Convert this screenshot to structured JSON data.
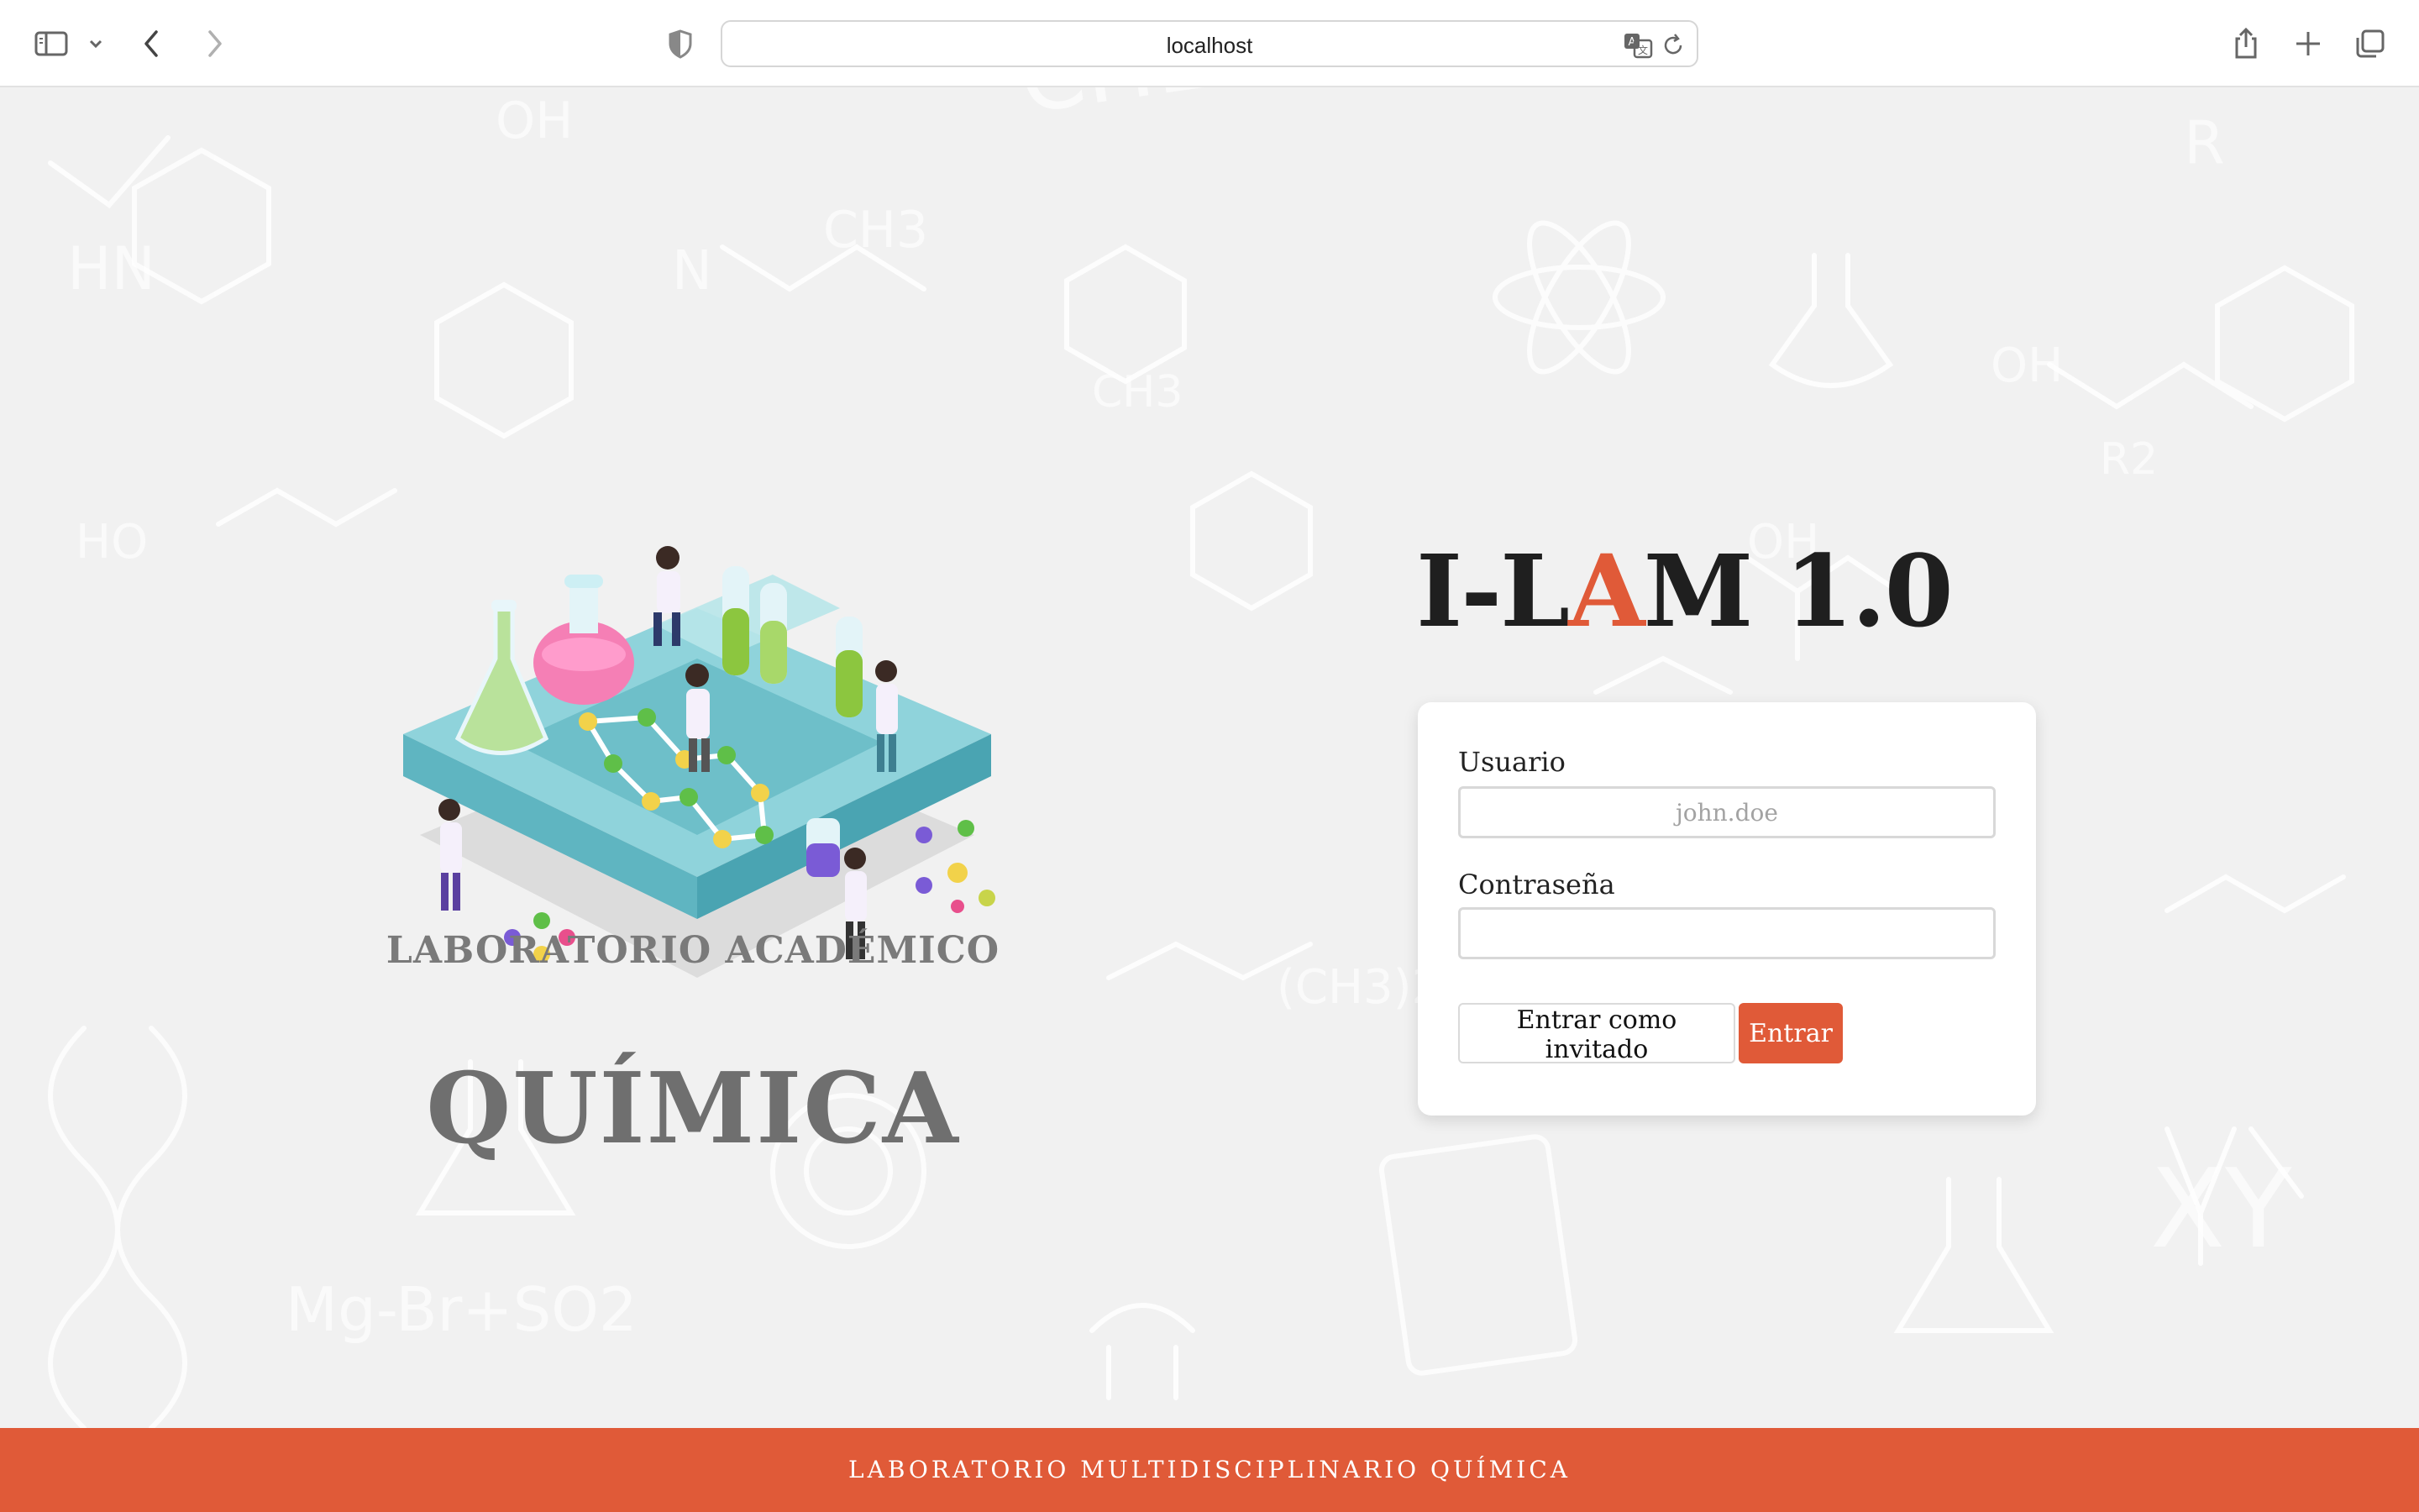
{
  "browser": {
    "url": "localhost"
  },
  "hero": {
    "lab_title": "LABORATORIO ACADÉMICO",
    "subject": "QUÍMICA"
  },
  "brand": {
    "prefix": "I-L",
    "accent_letter": "A",
    "suffix": "M 1.0"
  },
  "login": {
    "user_label": "Usuario",
    "user_placeholder": "john.doe",
    "user_value": "",
    "password_label": "Contraseña",
    "password_value": "",
    "guest_button": "Entrar como invitado",
    "submit_button": "Entrar"
  },
  "footer": {
    "text": "LABORATORIO MULTIDISCIPLINARIO QUÍMICA"
  },
  "colors": {
    "accent": "#e05a38",
    "background": "#f1f1f1",
    "card": "#ffffff",
    "brand_text": "#1f1f1f",
    "hero_text": "#6f6f6f"
  },
  "icons": {
    "sidebar": "sidebar-icon",
    "sidebar_menu": "chevron-down-icon",
    "back": "chevron-left-icon",
    "forward": "chevron-right-icon",
    "privacy": "shield-icon",
    "translate": "translate-icon",
    "reload": "reload-icon",
    "share": "share-icon",
    "new_tab": "plus-icon",
    "tabs": "tabs-overview-icon"
  }
}
